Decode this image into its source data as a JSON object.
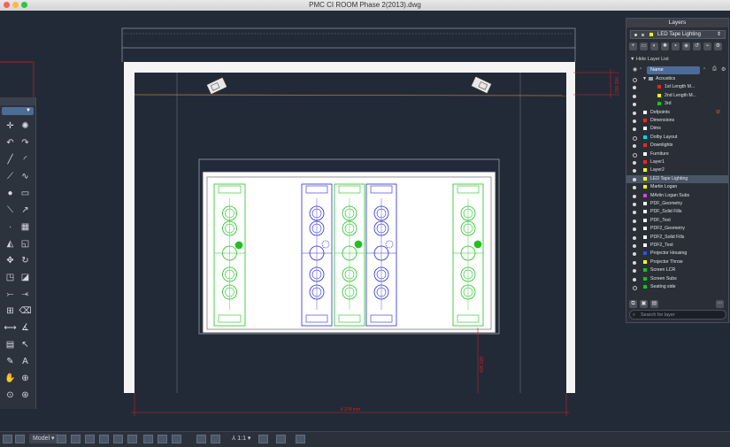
{
  "window": {
    "title": "PMC CI ROOM Phase 2(2013).dwg",
    "buttons": [
      {
        "name": "close",
        "color": "#fc5f57"
      },
      {
        "name": "minimize",
        "color": "#fdbd2e"
      },
      {
        "name": "zoom",
        "color": "#28c840"
      }
    ]
  },
  "drawing": {
    "dim_right": "200 200",
    "dim_vertical": "405 228",
    "dim_horizontal": "4 274 mm"
  },
  "toolbox": {
    "dropdown_icon": "chevron-down-icon",
    "tools": [
      "move-icon",
      "render-icon",
      "undo-icon",
      "redo-icon",
      "line-icon",
      "arc-icon",
      "polyline-icon",
      "spline-icon",
      "circle-icon",
      "rectangle-icon",
      "construction-line-icon",
      "ray-icon",
      "point-icon",
      "hatch-icon",
      "mirror-icon",
      "offset-icon",
      "move-tool-icon",
      "rotate-icon",
      "scale-icon",
      "stretch-icon",
      "trim-icon",
      "extend-icon",
      "array-icon",
      "erase-icon",
      "dimension-icon",
      "angular-dimension-icon",
      "table-icon",
      "leader-icon",
      "pen-icon",
      "text-icon",
      "pan-icon",
      "zoom-in-icon",
      "zoom-window-icon",
      "zoom-extents-icon"
    ]
  },
  "layers_panel": {
    "title": "Layers",
    "current_layer": "LED Tape Lighting",
    "current_color": "#ffff00",
    "hide_label": "Hide Layer List",
    "name_header": "Name",
    "search_placeholder": "Search for layer",
    "rows": [
      {
        "name": "Acoustics",
        "color": "#9aa7b7",
        "indent": 1,
        "visible": false
      },
      {
        "name": "1st Length M...",
        "color": "#ff2020",
        "indent": 2,
        "visible": true
      },
      {
        "name": "2nd Length M...",
        "color": "#ffff00",
        "indent": 2,
        "visible": true
      },
      {
        "name": "3rd",
        "color": "#00d000",
        "indent": 2,
        "visible": true
      },
      {
        "name": "Defpoints",
        "color": "#ffffff",
        "indent": 0,
        "visible": true
      },
      {
        "name": "Dimensions",
        "color": "#ff2020",
        "indent": 0,
        "visible": true
      },
      {
        "name": "Dims",
        "color": "#ffffff",
        "indent": 0,
        "visible": true
      },
      {
        "name": "Dolby Layout",
        "color": "#00d8ff",
        "indent": 0,
        "visible": false
      },
      {
        "name": "Downlights",
        "color": "#ff2020",
        "indent": 0,
        "visible": true
      },
      {
        "name": "Furniture",
        "color": "#ffffff",
        "indent": 0,
        "visible": false
      },
      {
        "name": "Layer1",
        "color": "#ff2020",
        "indent": 0,
        "visible": true
      },
      {
        "name": "Layer2",
        "color": "#ffff00",
        "indent": 0,
        "visible": true
      },
      {
        "name": "LED Tape Lighting",
        "color": "#ffff00",
        "indent": 0,
        "visible": true,
        "selected": true
      },
      {
        "name": "Martin Logan",
        "color": "#ffff00",
        "indent": 0,
        "visible": true
      },
      {
        "name": "MArtin Logan Subs",
        "color": "#e040e0",
        "indent": 0,
        "visible": true
      },
      {
        "name": "PDF_Geometry",
        "color": "#ffffff",
        "indent": 0,
        "visible": true
      },
      {
        "name": "PDF_Solid Fills",
        "color": "#ffffff",
        "indent": 0,
        "visible": true
      },
      {
        "name": "PDF_Text",
        "color": "#ffffff",
        "indent": 0,
        "visible": true
      },
      {
        "name": "PDF2_Geometry",
        "color": "#ffffff",
        "indent": 0,
        "visible": true
      },
      {
        "name": "PDF2_Solid Fills",
        "color": "#ffffff",
        "indent": 0,
        "visible": true
      },
      {
        "name": "PDF2_Text",
        "color": "#ffffff",
        "indent": 0,
        "visible": true
      },
      {
        "name": "Projector Housing",
        "color": "#3050ff",
        "indent": 0,
        "visible": true
      },
      {
        "name": "Projector Throw",
        "color": "#ffff00",
        "indent": 0,
        "visible": true
      },
      {
        "name": "Screen LCR",
        "color": "#00d000",
        "indent": 0,
        "visible": true
      },
      {
        "name": "Screen Subs",
        "color": "#00d000",
        "indent": 0,
        "visible": true
      },
      {
        "name": "Seating side",
        "color": "#00d000",
        "indent": 0,
        "visible": false
      }
    ]
  },
  "statusbar": {
    "model_tab": "Model",
    "scale": "1:1"
  }
}
